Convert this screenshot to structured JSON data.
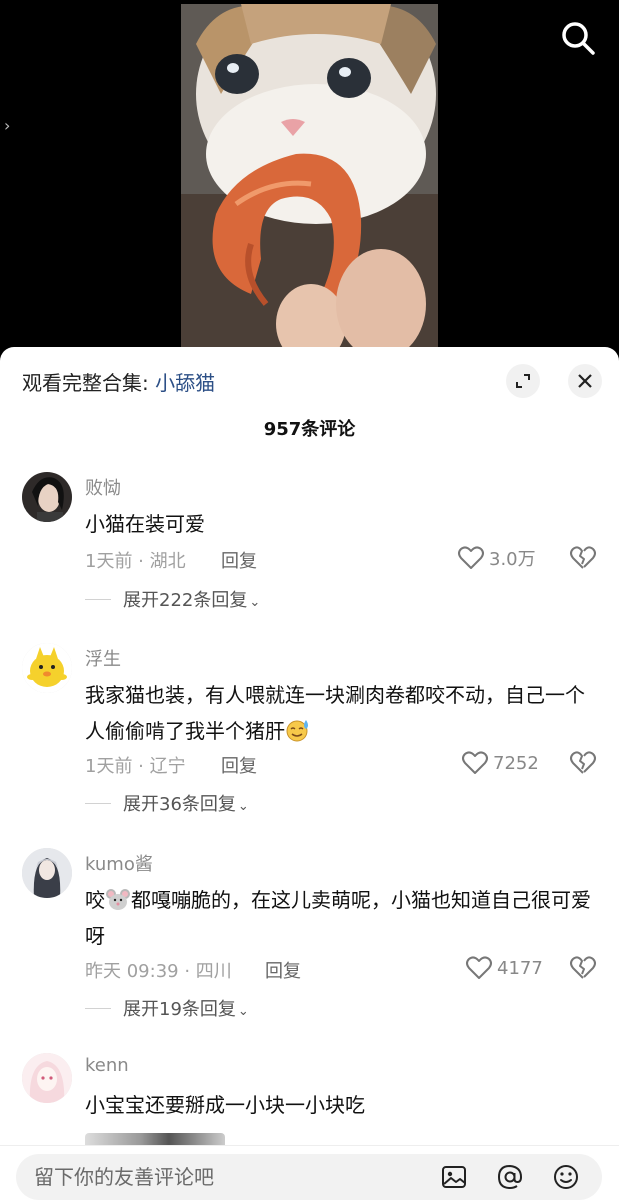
{
  "video": {
    "side_chevron": "›",
    "search_icon": "search-icon"
  },
  "sheet": {
    "collection_prefix": "观看完整合集: ",
    "collection_name": "小舔猫",
    "comment_count": "957条评论"
  },
  "comments": [
    {
      "username": "败恸",
      "text": "小猫在装可爱",
      "time": "1天前 · 湖北",
      "reply": "回复",
      "likes": "3.0万",
      "expand": "展开222条回复"
    },
    {
      "username": "浮生",
      "text": "我家猫也装，有人喂就连一块涮肉卷都咬不动，自己一个人偷偷啃了我半个猪肝",
      "time": "1天前 · 辽宁",
      "reply": "回复",
      "likes": "7252",
      "expand": "展开36条回复"
    },
    {
      "username": "kumo酱",
      "text_before": "咬",
      "text_after": "都嘎嘣脆的，在这儿卖萌呢，小猫也知道自己很可爱呀",
      "time": "昨天 09:39 · 四川",
      "reply": "回复",
      "likes": "4177",
      "expand": "展开19条回复"
    },
    {
      "username": "kenn",
      "text": "小宝宝还要掰成一小块一小块吃"
    }
  ],
  "input": {
    "placeholder": "留下你的友善评论吧"
  },
  "icons": {
    "search": "search-icon",
    "expand": "expand-icon",
    "close": "close-icon",
    "heart": "heart-icon",
    "dislike": "broken-heart-icon",
    "image": "image-icon",
    "mention": "at-icon",
    "emoji": "emoji-icon"
  },
  "colors": {
    "accent_link": "#2c4f86",
    "muted_text": "#8a8a8a"
  }
}
